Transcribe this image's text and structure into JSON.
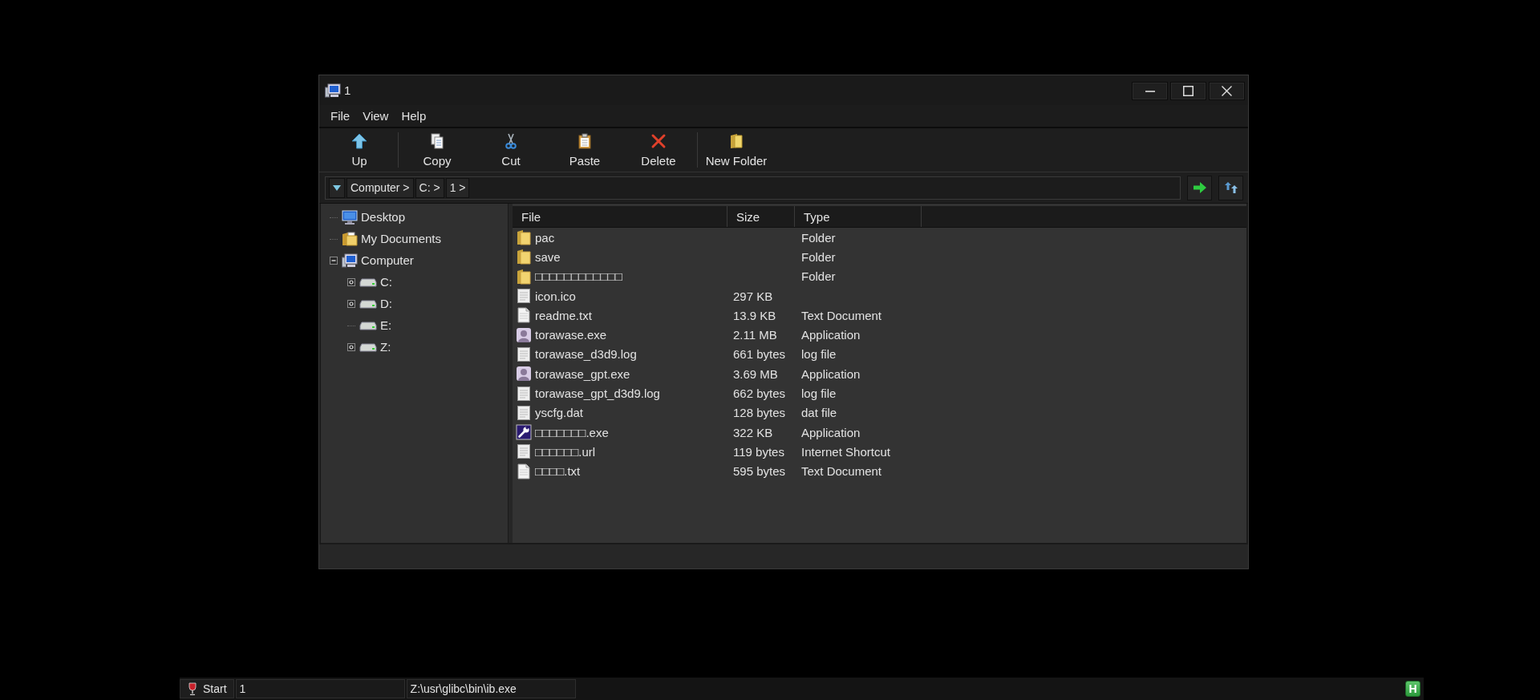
{
  "window": {
    "title": "1"
  },
  "menu": [
    "File",
    "View",
    "Help"
  ],
  "toolbar": {
    "groups": [
      {
        "buttons": [
          {
            "label": "Up",
            "kind": "up"
          }
        ]
      },
      {
        "buttons": [
          {
            "label": "Copy",
            "kind": "copy"
          },
          {
            "label": "Cut",
            "kind": "cut"
          },
          {
            "label": "Paste",
            "kind": "paste"
          },
          {
            "label": "Delete",
            "kind": "delete"
          }
        ]
      },
      {
        "buttons": [
          {
            "label": "New Folder",
            "kind": "new_folder"
          }
        ]
      }
    ]
  },
  "address_bar": {
    "breadcrumbs": [
      "Computer >",
      "C: >",
      "1 >"
    ]
  },
  "sidebar": {
    "tree": [
      {
        "label": "Desktop",
        "kind": "desktop"
      },
      {
        "label": "My Documents",
        "kind": "documents"
      },
      {
        "label": "Computer",
        "kind": "computer",
        "expanded": true,
        "children": [
          {
            "label": "C:",
            "kind": "drive",
            "expanded": false
          },
          {
            "label": "D:",
            "kind": "drive",
            "expanded": false
          },
          {
            "label": "E:",
            "kind": "drive"
          },
          {
            "label": "Z:",
            "kind": "drive",
            "expanded": false
          }
        ]
      }
    ]
  },
  "file_list": {
    "columns": [
      "File",
      "Size",
      "Type"
    ],
    "rows": [
      {
        "name": "pac",
        "kind": "folder",
        "type": "Folder"
      },
      {
        "name": "save",
        "kind": "folder",
        "type": "Folder"
      },
      {
        "name": "□□□□□□□□□□□□",
        "kind": "folder",
        "type": "Folder"
      },
      {
        "name": "icon.ico",
        "kind": "document",
        "size": "297 KB"
      },
      {
        "name": "readme.txt",
        "kind": "text",
        "size": "13.9 KB",
        "type": "Text Document"
      },
      {
        "name": "torawase.exe",
        "kind": "app",
        "size": "2.11 MB",
        "type": "Application"
      },
      {
        "name": "torawase_d3d9.log",
        "kind": "document",
        "size": "661 bytes",
        "type": "log file"
      },
      {
        "name": "torawase_gpt.exe",
        "kind": "app",
        "size": "3.69 MB",
        "type": "Application"
      },
      {
        "name": "torawase_gpt_d3d9.log",
        "kind": "document",
        "size": "662 bytes",
        "type": "log file"
      },
      {
        "name": "yscfg.dat",
        "kind": "document",
        "size": "128 bytes",
        "type": "dat file"
      },
      {
        "name": "□□□□□□□.exe",
        "kind": "tool",
        "size": "322 KB",
        "type": "Application"
      },
      {
        "name": "□□□□□□.url",
        "kind": "document",
        "size": "119 bytes",
        "type": "Internet Shortcut"
      },
      {
        "name": "□□□□.txt",
        "kind": "text",
        "size": "595 bytes",
        "type": "Text Document"
      }
    ]
  },
  "taskbar": {
    "start": "Start",
    "tasks": [
      "1",
      "Z:\\usr\\glibc\\bin\\ib.exe"
    ],
    "tray": [
      "H"
    ]
  }
}
